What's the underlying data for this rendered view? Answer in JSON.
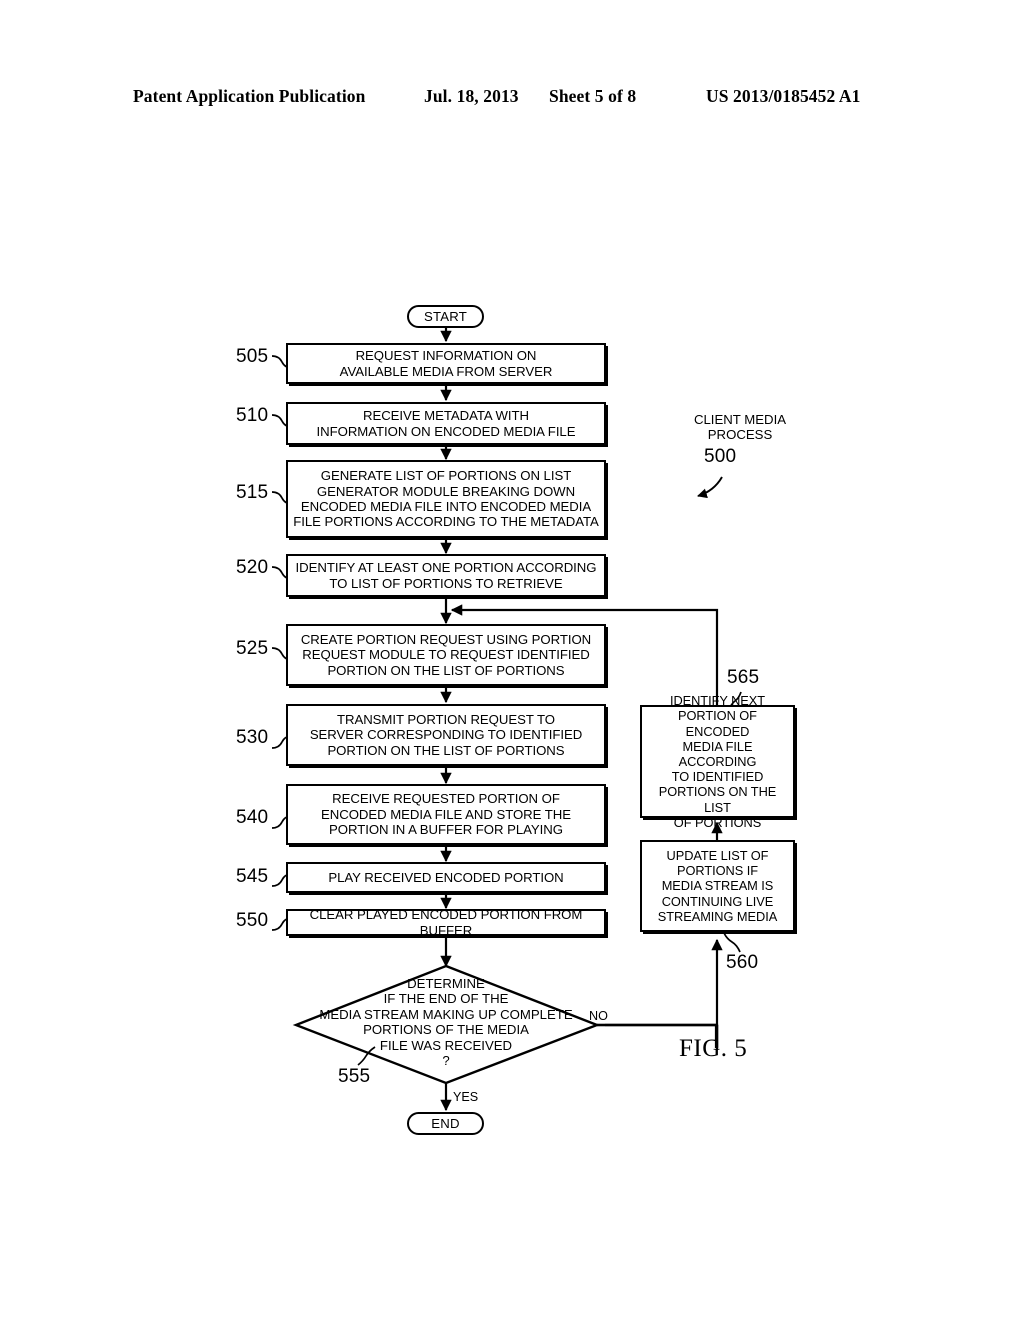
{
  "header": {
    "publication": "Patent Application Publication",
    "date": "Jul. 18, 2013",
    "sheet": "Sheet 5 of 8",
    "patent_number": "US 2013/0185452 A1"
  },
  "figure": {
    "label": "FIG. 5",
    "process_annotation": "CLIENT MEDIA\nPROCESS",
    "process_number": "500"
  },
  "flowchart": {
    "start_label": "START",
    "end_label": "END",
    "yes_label": "YES",
    "no_label": "NO",
    "steps": [
      {
        "ref": "505",
        "text": "REQUEST INFORMATION ON\nAVAILABLE MEDIA FROM SERVER"
      },
      {
        "ref": "510",
        "text": "RECEIVE METADATA WITH\nINFORMATION ON ENCODED MEDIA FILE"
      },
      {
        "ref": "515",
        "text": "GENERATE LIST OF PORTIONS ON LIST\nGENERATOR MODULE BREAKING DOWN\nENCODED MEDIA FILE INTO ENCODED MEDIA\nFILE PORTIONS ACCORDING TO THE METADATA"
      },
      {
        "ref": "520",
        "text": "IDENTIFY AT LEAST ONE PORTION ACCORDING\nTO LIST OF PORTIONS TO RETRIEVE"
      },
      {
        "ref": "525",
        "text": "CREATE PORTION REQUEST USING PORTION\nREQUEST MODULE TO REQUEST IDENTIFIED\nPORTION ON THE LIST OF PORTIONS"
      },
      {
        "ref": "530",
        "text": "TRANSMIT PORTION REQUEST TO\nSERVER CORRESPONDING TO IDENTIFIED\nPORTION ON THE LIST OF PORTIONS"
      },
      {
        "ref": "540",
        "text": "RECEIVE REQUESTED PORTION OF\nENCODED MEDIA FILE AND STORE THE\nPORTION IN A BUFFER FOR PLAYING"
      },
      {
        "ref": "545",
        "text": "PLAY RECEIVED ENCODED PORTION"
      },
      {
        "ref": "550",
        "text": "CLEAR PLAYED ENCODED PORTION FROM BUFFER"
      }
    ],
    "decision": {
      "ref": "555",
      "text": "DETERMINE\nIF THE END OF THE\nMEDIA STREAM MAKING UP COMPLETE\nPORTIONS OF THE MEDIA\nFILE WAS RECEIVED\n?"
    },
    "right_steps": [
      {
        "ref": "565",
        "text": "IDENTIFY NEXT\nPORTION OF ENCODED\nMEDIA FILE ACCORDING\nTO IDENTIFIED\nPORTIONS ON THE LIST\nOF PORTIONS"
      },
      {
        "ref": "560",
        "text": "UPDATE LIST OF\nPORTIONS IF\nMEDIA STREAM IS\nCONTINUING LIVE\nSTREAMING MEDIA"
      }
    ]
  }
}
